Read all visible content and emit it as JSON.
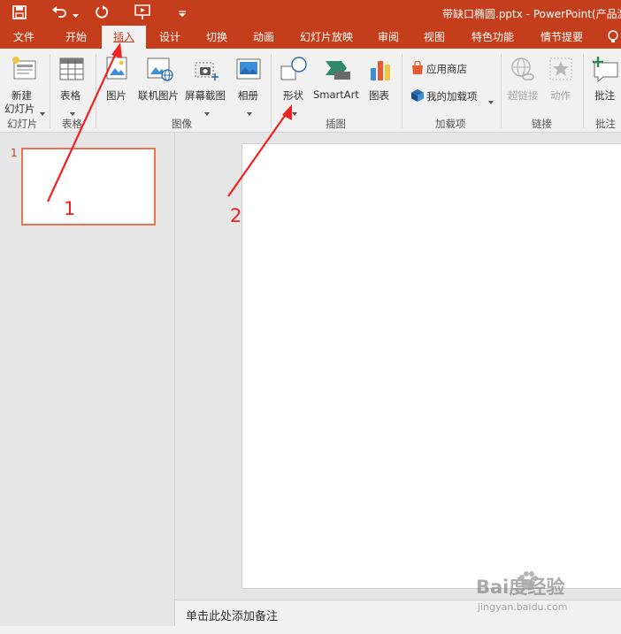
{
  "window": {
    "title": "带缺口椭圆.pptx - PowerPoint(产品激"
  },
  "quick_access": {
    "save_icon": "save-icon",
    "undo_icon": "undo-icon",
    "redo_icon": "repeat-icon",
    "present_icon": "start-from-beginning-icon",
    "customize_icon": "customize-toolbar-icon"
  },
  "tabs": [
    {
      "label": "文件"
    },
    {
      "label": "开始"
    },
    {
      "label": "插入"
    },
    {
      "label": "设计"
    },
    {
      "label": "切换"
    },
    {
      "label": "动画"
    },
    {
      "label": "幻灯片放映"
    },
    {
      "label": "审阅"
    },
    {
      "label": "视图"
    },
    {
      "label": "特色功能"
    },
    {
      "label": "情节提要"
    }
  ],
  "ribbon": {
    "new_slide": {
      "line1": "新建",
      "line2": "幻灯片"
    },
    "table": {
      "label": "表格"
    },
    "picture": {
      "label": "图片"
    },
    "online_picture": {
      "label": "联机图片"
    },
    "screenshot": {
      "label": "屏幕截图"
    },
    "album": {
      "label": "相册"
    },
    "shapes": {
      "label": "形状"
    },
    "smartart": {
      "label": "SmartArt"
    },
    "chart": {
      "label": "图表"
    },
    "store": {
      "label": "应用商店"
    },
    "my_addins": {
      "label": "我的加载项"
    },
    "hyperlink": {
      "label": "超链接"
    },
    "action": {
      "label": "动作"
    },
    "comment": {
      "label": "批注"
    },
    "groups": {
      "slides": "幻灯片",
      "tables": "表格",
      "images": "图像",
      "illustrations": "插图",
      "addins": "加载项",
      "links": "链接",
      "comments": "批注"
    }
  },
  "thumbnails": [
    {
      "number": "1"
    }
  ],
  "annotations": [
    {
      "label": "1"
    },
    {
      "label": "2"
    }
  ],
  "notes": {
    "placeholder": "单击此处添加备注"
  },
  "watermark": {
    "brand": "Bai度经验",
    "url": "jingyan.baidu.com"
  },
  "colors": {
    "accent": "#c43e1c",
    "annotation": "#ee2222",
    "thumb_border": "#e8734f"
  }
}
